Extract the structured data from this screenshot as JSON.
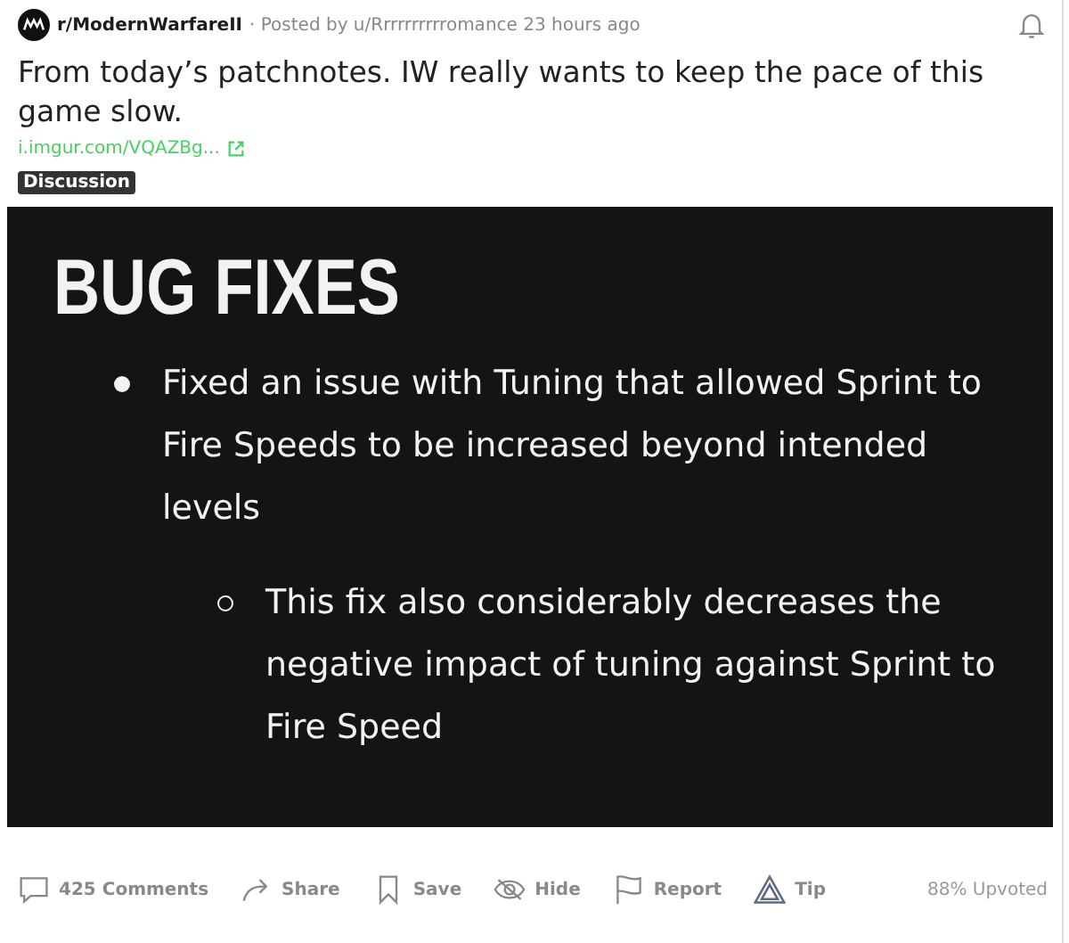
{
  "post": {
    "subreddit": "r/ModernWarfareII",
    "meta": "· Posted by u/Rrrrrrrrrromance 23 hours ago",
    "title": "From today’s patchnotes. IW really wants to keep the pace of this game slow.",
    "link": "i.imgur.com/VQAZBg...",
    "flair": "Discussion"
  },
  "image": {
    "heading": "BUG FIXES",
    "bullets": [
      {
        "text": "Fixed an issue with Tuning that allowed Sprint to Fire Speeds to be increased beyond intended levels",
        "children": [
          {
            "text": "This fix also considerably decreases the negative impact of tuning against Sprint to Fire Speed"
          }
        ]
      }
    ]
  },
  "actions": [
    {
      "kind": "comments",
      "label": "425 Comments"
    },
    {
      "kind": "share",
      "label": "Share"
    },
    {
      "kind": "save",
      "label": "Save"
    },
    {
      "kind": "hide",
      "label": "Hide"
    },
    {
      "kind": "report",
      "label": "Report"
    },
    {
      "kind": "tip",
      "label": "Tip"
    }
  ],
  "upvoted": "88% Upvoted"
}
